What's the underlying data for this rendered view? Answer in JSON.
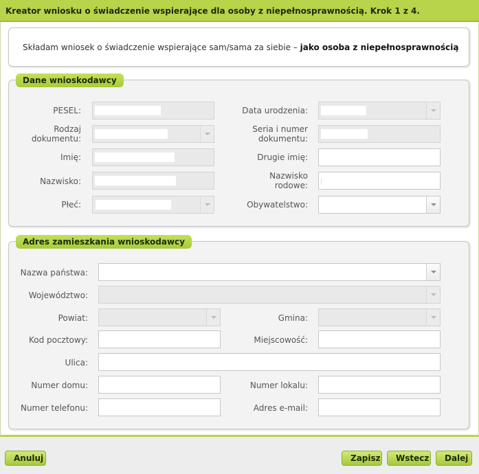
{
  "header": {
    "title": "Kreator wniosku o świadczenie wspierające dla osoby z niepełnosprawnością. Krok 1 z 4."
  },
  "intro": {
    "text": "Składam wniosek o świadczenie wspierające  sam/sama za siebie – ",
    "bold": "jako osoba z niepełnosprawnością"
  },
  "applicant": {
    "title": "Dane wnioskodawcy",
    "pesel_label": "PESEL:",
    "birth_label": "Data urodzenia:",
    "doc_type_label_1": "Rodzaj",
    "doc_type_label_2": "dokumentu:",
    "doc_number_label_1": "Seria i numer",
    "doc_number_label_2": "dokumentu:",
    "first_name_label": "Imię:",
    "second_name_label": "Drugie imię:",
    "last_name_label": "Nazwisko:",
    "family_name_label_1": "Nazwisko",
    "family_name_label_2": "rodowe:",
    "sex_label": "Płeć:",
    "citizenship_label": "Obywatelstwo:"
  },
  "address": {
    "title": "Adres zamieszkania wnioskodawcy",
    "country_label": "Nazwa państwa:",
    "province_label": "Województwo:",
    "county_label": "Powiat:",
    "commune_label": "Gmina:",
    "postal_label": "Kod pocztowy:",
    "city_label": "Miejscowość:",
    "street_label": "Ulica:",
    "house_label": "Numer domu:",
    "flat_label": "Numer lokalu:",
    "phone_label": "Numer telefonu:",
    "email_label": "Adres e-mail:"
  },
  "footer": {
    "cancel": "Anuluj",
    "save": "Zapisz",
    "back": "Wstecz",
    "next": "Dalej"
  },
  "colors": {
    "accent": "#b7d44a",
    "accent_dark": "#9dbd2e",
    "panel": "#f3f3f3",
    "disabled_field": "#e9e9e9"
  }
}
